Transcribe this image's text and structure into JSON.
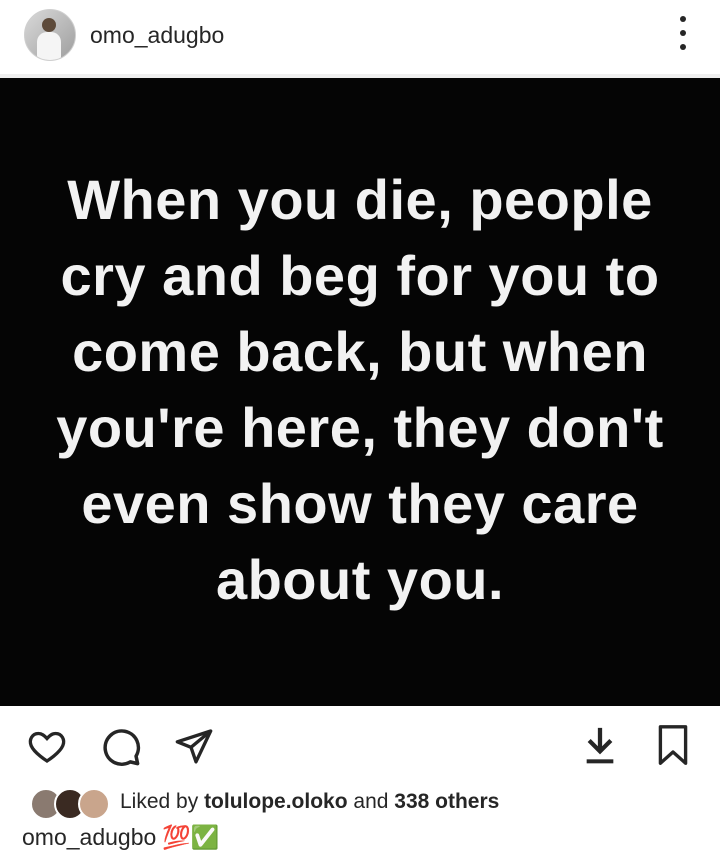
{
  "post": {
    "username": "omo_adugbo",
    "quote_text": "When you die, people cry and beg for you to come back, but when you're here, they don't even show they care about you."
  },
  "icons": {
    "more": "more-vertical-icon",
    "like": "heart-icon",
    "comment": "comment-icon",
    "share": "send-icon",
    "download": "download-icon",
    "save": "bookmark-icon"
  },
  "likes": {
    "prefix": "Liked by",
    "liker": "tolulope.oloko",
    "joiner": "and",
    "others": "338 others"
  },
  "caption": {
    "username": "omo_adugbo",
    "emoji": "💯✅"
  },
  "colors": {
    "text": "#262626",
    "post_background": "#050505",
    "post_text": "#f2f2f2",
    "divider": "#efefef"
  }
}
